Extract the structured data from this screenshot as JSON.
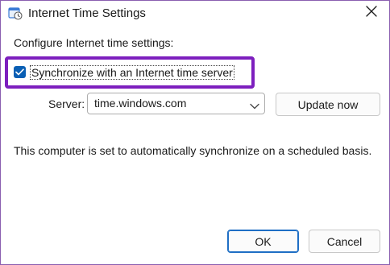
{
  "window": {
    "title": "Internet Time Settings"
  },
  "settings": {
    "section_label": "Configure Internet time settings:",
    "sync_checkbox": {
      "label": "Synchronize with an Internet time server",
      "checked": true
    },
    "server": {
      "label": "Server:",
      "value": "time.windows.com"
    },
    "update_button_label": "Update now",
    "status_text": "This computer is set to automatically synchronize on a scheduled basis."
  },
  "footer": {
    "ok_label": "OK",
    "cancel_label": "Cancel"
  },
  "colors": {
    "highlight": "#7d1fbe",
    "checkbox_fill": "#0a5fb4",
    "default_button_border": "#1f6fc5"
  },
  "icons": {
    "title": "clock-calendar-icon",
    "close": "close-icon",
    "dropdown": "chevron-down-icon",
    "check": "checkmark-icon"
  }
}
